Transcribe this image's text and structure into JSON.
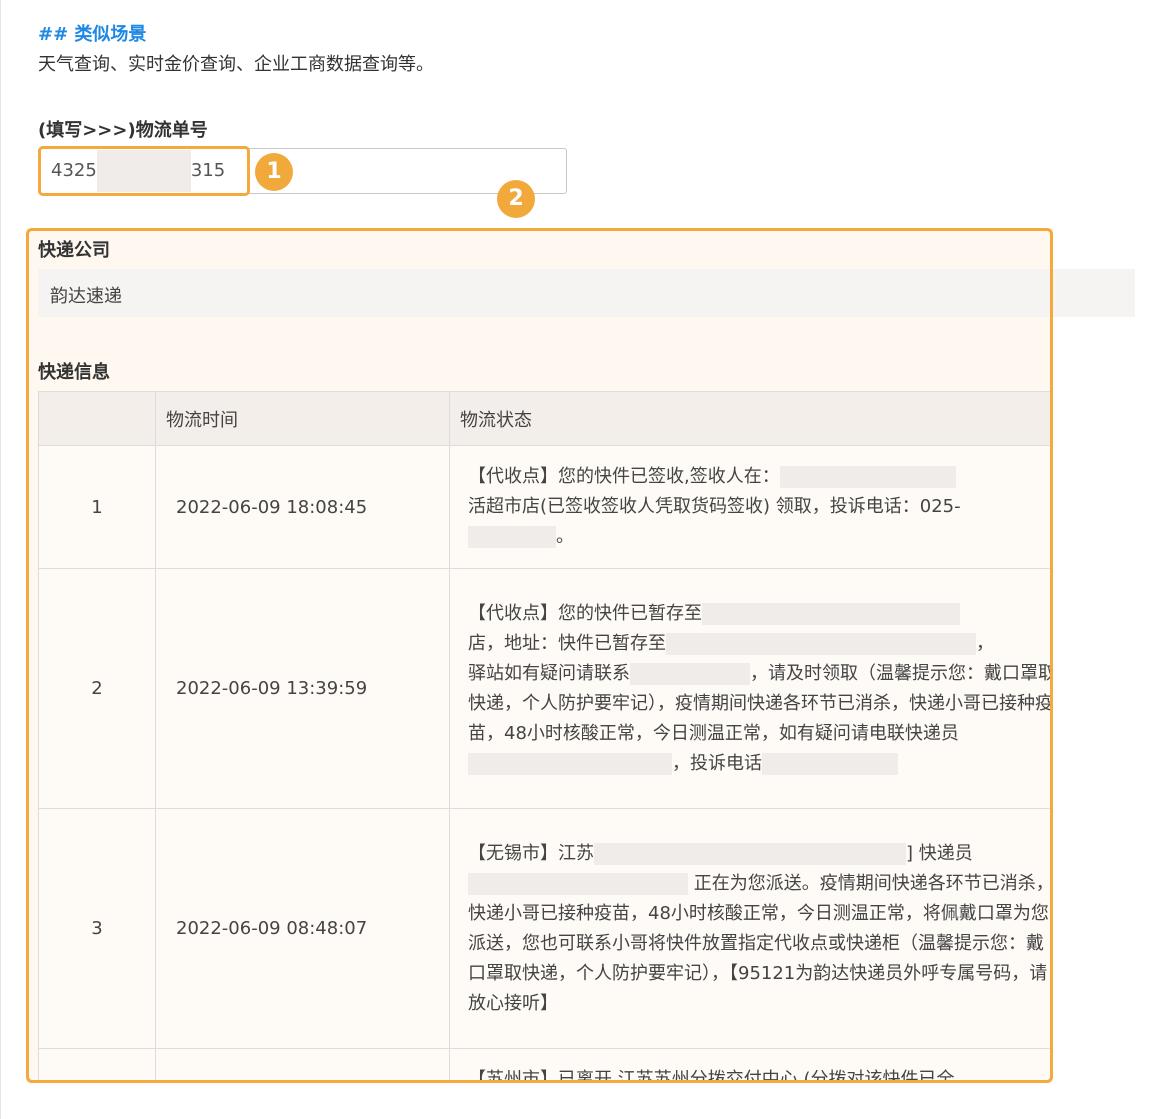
{
  "section": {
    "heading": "## 类似场景",
    "intro": "天气查询、实时金价查询、企业工商数据查询等。"
  },
  "form": {
    "label": "(填写>>>)物流单号",
    "tracking_prefix": "4325",
    "tracking_suffix": "315"
  },
  "markers": [
    "1",
    "2"
  ],
  "result": {
    "company_title": "快递公司",
    "company_value": "韵达速递",
    "info_title": "快递信息",
    "columns": [
      "",
      "物流时间",
      "物流状态"
    ],
    "rows": [
      {
        "index": "1",
        "time": "2022-06-09 18:08:45",
        "status": [
          "【代收点】您的快件已签收,签收人在：",
          "活超市店(已签收签收人凭取货码签收) 领取，投诉电话：025-",
          "。"
        ]
      },
      {
        "index": "2",
        "time": "2022-06-09 13:39:59",
        "status": [
          "【代收点】您的快件已暂存至",
          "店，地址：快件已暂存至",
          "，",
          "驿站如有疑问请联系",
          "，请及时领取（温馨提示您：戴口罩取快递，个人防护要牢记），疫情期间快递各环节已消杀，快递小哥已接种疫苗，48小时核酸正常，今日测温正常，如有疑问请电联快递员",
          "，投诉电话"
        ]
      },
      {
        "index": "3",
        "time": "2022-06-09 08:48:07",
        "status": [
          "【无锡市】江苏",
          "] 快递员",
          "正在为您派送。疫情期间快递各环节已消杀，快递小哥已接种疫苗，48小时核酸正常，今日测温正常，将佩戴口罩为您派送，您也可联系小哥将快件放置指定代收点或快递柜（温馨提示您：戴口罩取快递，个人防护要牢记），【95121为韵达快递员外呼专属号码，请放心接听】"
        ]
      },
      {
        "index": "",
        "time": "",
        "status": [
          "【苏州市】已离开 江苏苏州分拨交付中心 (分拨对该快件已全"
        ]
      }
    ]
  },
  "colors": {
    "accent": "#1e88e5",
    "highlight": "#f4a93c",
    "marker": "#f2a93b",
    "panel_bg": "#fef8f0"
  }
}
